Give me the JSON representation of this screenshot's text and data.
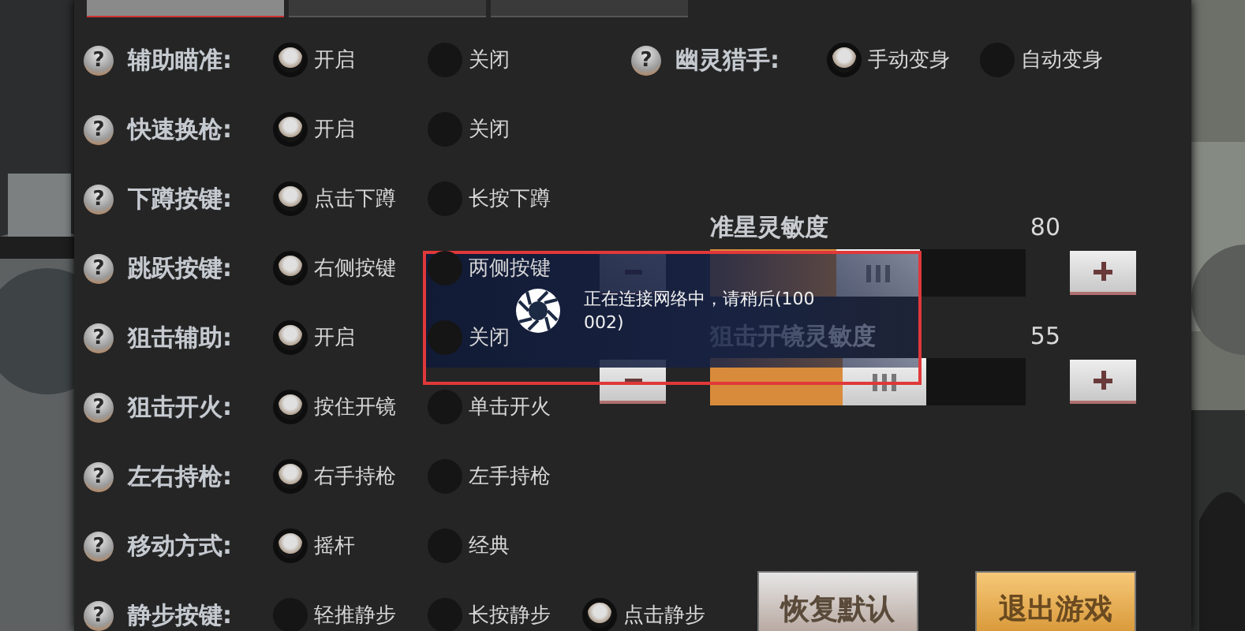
{
  "tabs": [
    {
      "selected": true
    },
    {
      "selected": false
    },
    {
      "selected": false
    }
  ],
  "settings": [
    {
      "help": "?",
      "label": "辅助瞄准:",
      "options": [
        {
          "label": "开启",
          "selected": true
        },
        {
          "label": "关闭",
          "selected": false
        }
      ]
    },
    {
      "help": "?",
      "label": "快速换枪:",
      "options": [
        {
          "label": "开启",
          "selected": true
        },
        {
          "label": "关闭",
          "selected": false
        }
      ]
    },
    {
      "help": "?",
      "label": "下蹲按键:",
      "options": [
        {
          "label": "点击下蹲",
          "selected": true
        },
        {
          "label": "长按下蹲",
          "selected": false
        }
      ]
    },
    {
      "help": "?",
      "label": "跳跃按键:",
      "options": [
        {
          "label": "右侧按键",
          "selected": true
        },
        {
          "label": "两侧按键",
          "selected": false
        }
      ]
    },
    {
      "help": "?",
      "label": "狙击辅助:",
      "options": [
        {
          "label": "开启",
          "selected": true
        },
        {
          "label": "关闭",
          "selected": false
        }
      ]
    },
    {
      "help": "?",
      "label": "狙击开火:",
      "options": [
        {
          "label": "按住开镜",
          "selected": true
        },
        {
          "label": "单击开火",
          "selected": false
        }
      ]
    },
    {
      "help": "?",
      "label": "左右持枪:",
      "options": [
        {
          "label": "右手持枪",
          "selected": true
        },
        {
          "label": "左手持枪",
          "selected": false
        }
      ]
    },
    {
      "help": "?",
      "label": "移动方式:",
      "options": [
        {
          "label": "摇杆",
          "selected": true
        },
        {
          "label": "经典",
          "selected": false
        }
      ]
    },
    {
      "help": "?",
      "label": "静步按键:",
      "options": [
        {
          "label": "轻推静步",
          "selected": false
        },
        {
          "label": "长按静步",
          "selected": false
        },
        {
          "label": "点击静步",
          "selected": true
        }
      ]
    }
  ],
  "ghost_hunter": {
    "help": "?",
    "label": "幽灵猎手:",
    "options": [
      {
        "label": "手动变身",
        "selected": true
      },
      {
        "label": "自动变身",
        "selected": false
      }
    ]
  },
  "sliders": [
    {
      "title": "准星灵敏度",
      "value": "80",
      "level": 0.4
    },
    {
      "title": "狙击开镜灵敏度",
      "value": "55",
      "level": 0.42
    }
  ],
  "buttons": [
    {
      "label": "恢复默认",
      "kind": "normal"
    },
    {
      "label": "退出游戏",
      "kind": "primary"
    }
  ],
  "toast": {
    "message": "正在连接网络中，请稍后(100002)"
  }
}
